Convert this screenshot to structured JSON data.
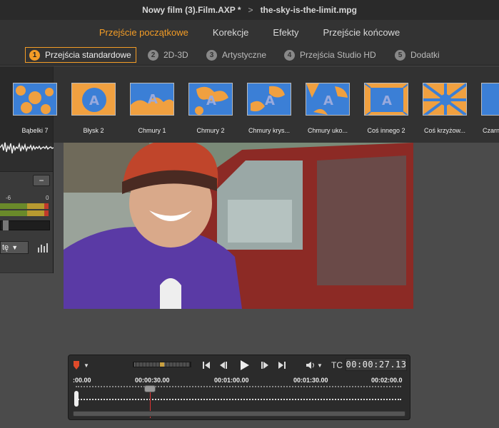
{
  "titlebar": {
    "project": "Nowy film (3).Film.AXP *",
    "separator": ">",
    "clip": "the-sky-is-the-limit.mpg"
  },
  "categories": [
    {
      "label": "Przejście początkowe",
      "active": true
    },
    {
      "label": "Korekcje",
      "active": false
    },
    {
      "label": "Efekty",
      "active": false
    },
    {
      "label": "Przejście końcowe",
      "active": false
    }
  ],
  "subtabs": [
    {
      "num": "1",
      "label": "Przejścia standardowe",
      "active": true
    },
    {
      "num": "2",
      "label": "2D-3D",
      "active": false
    },
    {
      "num": "3",
      "label": "Artystyczne",
      "active": false
    },
    {
      "num": "4",
      "label": "Przejścia Studio HD",
      "active": false
    },
    {
      "num": "5",
      "label": "Dodatki",
      "active": false
    }
  ],
  "thumbnails": [
    {
      "label": "Bąbelki 7"
    },
    {
      "label": "Błysk 2"
    },
    {
      "label": "Chmury 1"
    },
    {
      "label": "Chmury 2"
    },
    {
      "label": "Chmury krys..."
    },
    {
      "label": "Chmury uko..."
    },
    {
      "label": "Coś innego 2"
    },
    {
      "label": "Coś krzyżow..."
    },
    {
      "label": "Czarn"
    }
  ],
  "mixer": {
    "minus": "−",
    "scale_mid": "-6",
    "scale_zero": "0",
    "dropdown": "tę"
  },
  "player": {
    "tc_label": "TC",
    "timecode": "00:00:27.13",
    "ticks": [
      ":00.00",
      "00:00:30.00",
      "00:01:00.00",
      "00:01:30.00",
      "00:02:00.0"
    ]
  },
  "colors": {
    "accent": "#f39c26",
    "transition_blue": "#3b7fd6",
    "transition_orange": "#f0a040",
    "playhead": "#dd3333"
  }
}
